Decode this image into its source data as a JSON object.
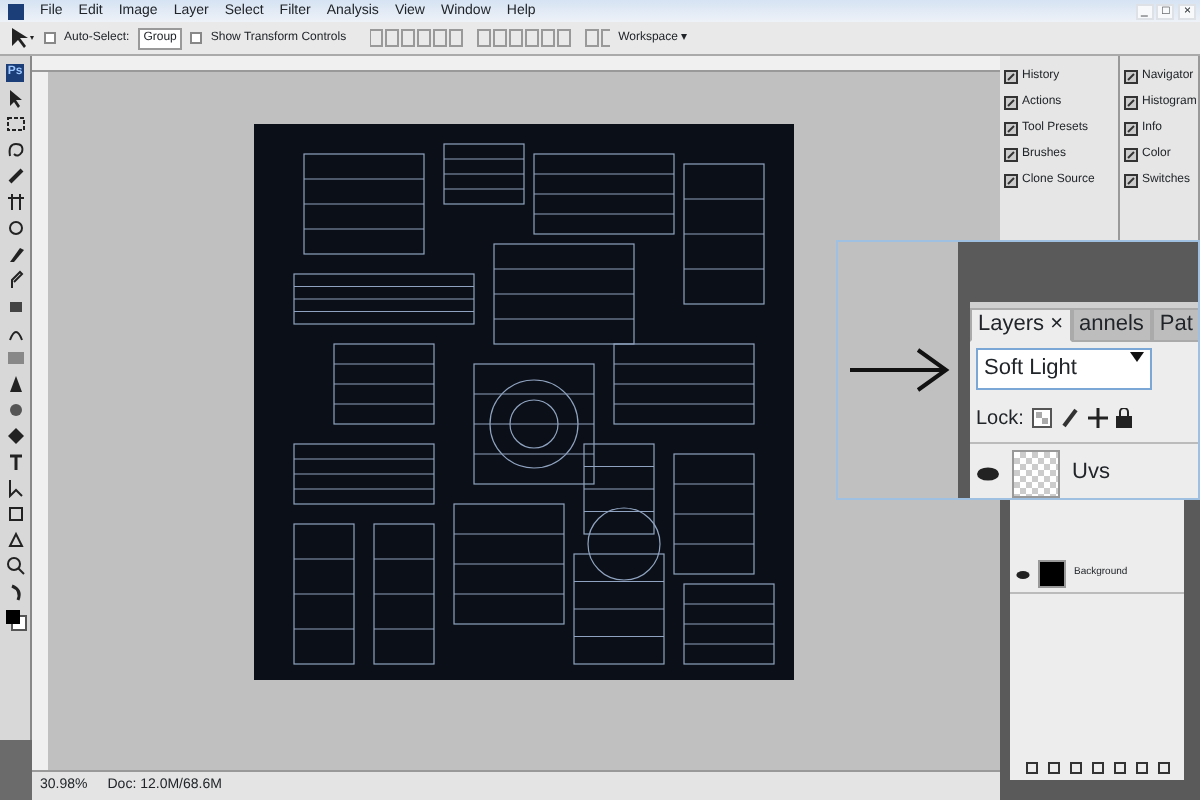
{
  "window_controls": [
    "_",
    "□",
    "×"
  ],
  "menu": [
    "File",
    "Edit",
    "Image",
    "Layer",
    "Select",
    "Filter",
    "Analysis",
    "View",
    "Window",
    "Help"
  ],
  "options_bar": {
    "auto_select": {
      "label": "Auto-Select:",
      "checked": false
    },
    "auto_select_mode": "Group",
    "show_transform_controls": {
      "label": "Show Transform Controls",
      "checked": false
    },
    "workspace": "Workspace ▾"
  },
  "toolbox": {
    "logo": "Ps"
  },
  "panels_left": [
    "History",
    "Actions",
    "Tool Presets",
    "Brushes",
    "Clone Source"
  ],
  "panels_right": [
    "Navigator",
    "Histogram",
    "Info",
    "Color",
    "Switches"
  ],
  "layers_panel": {
    "layers": [
      {
        "name": "Background",
        "visible": true
      }
    ]
  },
  "zoom_inset": {
    "tabs": [
      {
        "label": "Layers",
        "close": "×",
        "selected": true
      },
      {
        "label": "annels",
        "selected": false
      },
      {
        "label": "Pat",
        "selected": false
      }
    ],
    "blend_mode": "Soft Light",
    "lock_label": "Lock:",
    "layer": {
      "name": "Uvs",
      "visible": true
    }
  },
  "status_bar": {
    "zoom": "30.98%",
    "doc": "Doc: 12.0M/68.6M"
  }
}
